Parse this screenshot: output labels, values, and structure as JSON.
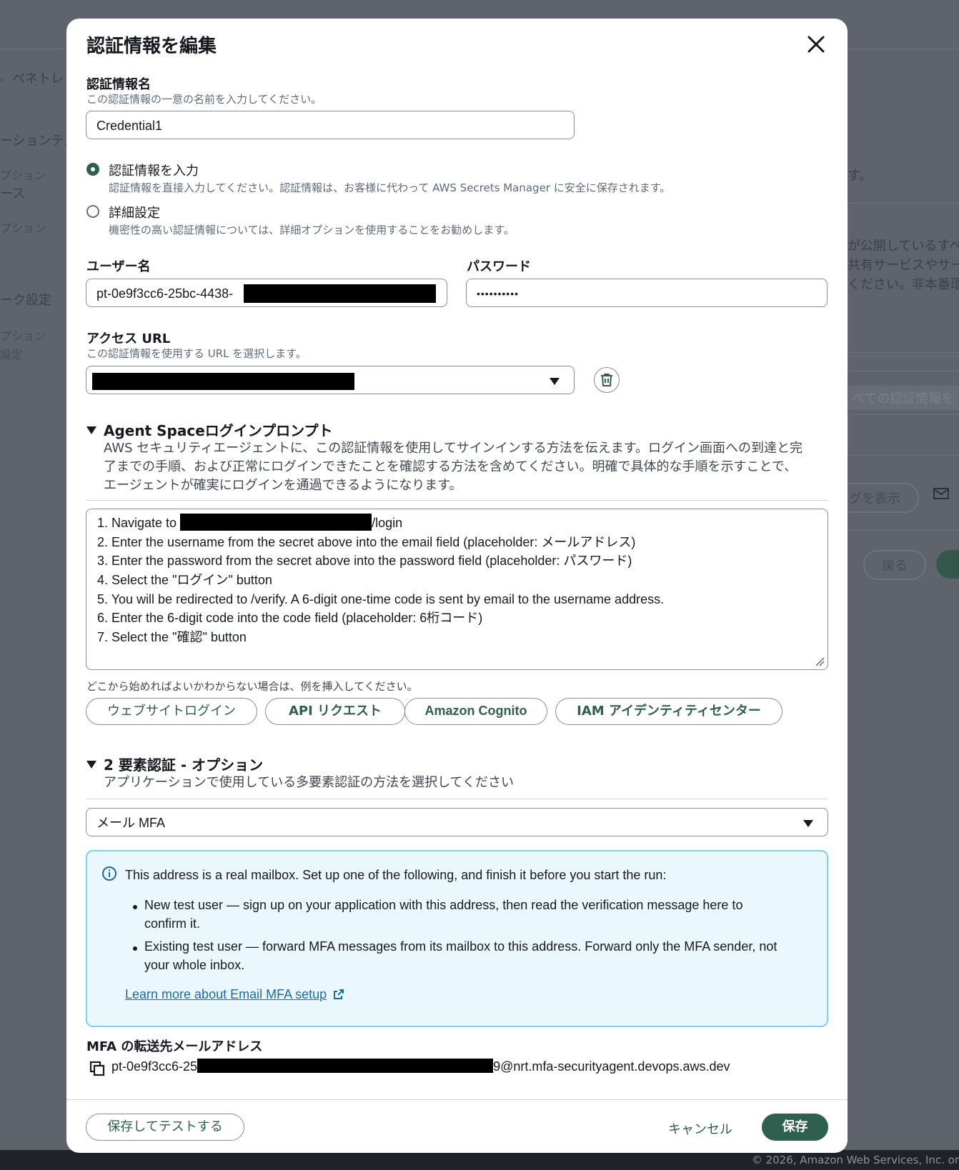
{
  "background": {
    "breadcrumb": "ペネトレ",
    "left_items": [
      "ーションテス",
      "プション",
      "ース",
      "プション",
      "ーク設定",
      "プション",
      "設定"
    ],
    "right_items": [
      "す。",
      "が公開しているすべ",
      "共有サービスやサー",
      "ください。非本番環",
      "べての認証情報を"
    ],
    "buttons": [
      "グを表示",
      "戻る"
    ],
    "copyright": "© 2026, Amazon Web Services, Inc. or"
  },
  "modal": {
    "title": "認証情報を編集",
    "credential_name": {
      "label": "認証情報名",
      "description": "この認証情報の一意の名前を入力してください。",
      "value": "Credential1"
    },
    "radio_options": [
      {
        "label": "認証情報を入力",
        "description": "認証情報を直接入力してください。認証情報は、お客様に代わって AWS Secrets Manager に安全に保存されます。",
        "selected": true
      },
      {
        "label": "詳細設定",
        "description": "機密性の高い認証情報については、詳細オプションを使用することをお勧めします。",
        "selected": false
      }
    ],
    "username": {
      "label": "ユーザー名",
      "value": "pt-0e9f3cc6-25bc-4438-"
    },
    "password": {
      "label": "パスワード",
      "value": "••••••••••"
    },
    "access_url": {
      "label": "アクセス URL",
      "description": "この認証情報を使用する URL を選択します。"
    },
    "login_prompt": {
      "heading": "Agent Spaceログインプロンプト",
      "description_lines": [
        "AWS セキュリティエージェントに、この認証情報を使用してサインインする方法を伝えます。ログイン画面への到達と完",
        "了までの手順、および正常にログインできたことを確認する方法を含めてください。明確で具体的な手順を示すことで、",
        "エージェントが確実にログインを通過できるようになります。"
      ],
      "steps": [
        "1. Navigate to ",
        "2. Enter the username from the secret above into the email field (placeholder: メールアドレス)",
        "3. Enter the password from the secret above into the password field (placeholder: パスワード)",
        "4. Select the \"ログイン\" button",
        "5. You will be redirected to /verify. A 6-digit one-time code is sent by email to the username address.",
        "6. Enter the 6-digit code into the code field (placeholder: 6桁コード)",
        "7. Select the \"確認\" button"
      ],
      "step1_suffix": "/login",
      "examples_hint": "どこから始めればよいかわからない場合は、例を挿入してください。",
      "examples": [
        "ウェブサイトログイン",
        "API リクエスト",
        "Amazon Cognito",
        "IAM アイデンティティセンター"
      ]
    },
    "mfa": {
      "heading": "2 要素認証 - オプション",
      "description": "アプリケーションで使用している多要素認証の方法を選択してください",
      "selected": "メール MFA",
      "alert": {
        "intro": "This address is a real mailbox. Set up one of the following, and finish it before you start the run:",
        "bullet1_line1": "New test user — sign up on your application with this address, then read the verification message here to",
        "bullet1_line2": "confirm it.",
        "bullet2_line1": "Existing test user — forward MFA messages from its mailbox to this address. Forward only the MFA sender, not",
        "bullet2_line2": "your whole inbox.",
        "link": "Learn more about Email MFA setup"
      },
      "forward_label": "MFA の転送先メールアドレス",
      "forward_prefix": "pt-0e9f3cc6-25",
      "forward_suffix": "9@nrt.mfa-securityagent.devops.aws.dev"
    },
    "footer": {
      "save_test": "保存してテストする",
      "cancel": "キャンセル",
      "save": "保存"
    }
  }
}
